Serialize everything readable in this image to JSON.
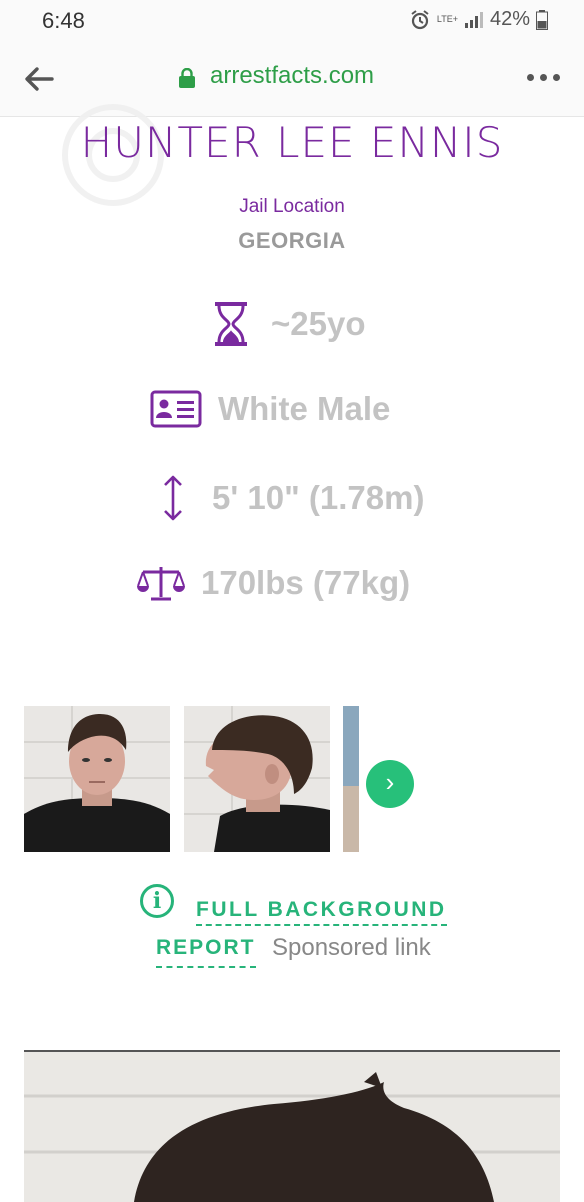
{
  "status_bar": {
    "time": "6:48",
    "network": "LTE+",
    "battery": "42%"
  },
  "browser": {
    "url": "arrestfacts.com"
  },
  "profile": {
    "name": "HUNTER LEE ENNIS",
    "jail_label": "Jail Location",
    "jail_value": "GEORGIA",
    "age": "~25yo",
    "race_gender": "White Male",
    "height": "5' 10\" (1.78m)",
    "weight": "170lbs (77kg)"
  },
  "colors": {
    "accent_purple": "#7a2a9f",
    "accent_green": "#27b47a",
    "url_green": "#2e9e48"
  },
  "icons": [
    "hourglass-icon",
    "id-card-icon",
    "height-arrow-icon",
    "scale-icon",
    "info-icon",
    "chevron-right-icon",
    "lock-icon",
    "back-arrow-icon",
    "more-dots-icon"
  ],
  "report": {
    "line1": "FULL BACKGROUND",
    "line2": "REPORT",
    "sponsored": "Sponsored link"
  }
}
